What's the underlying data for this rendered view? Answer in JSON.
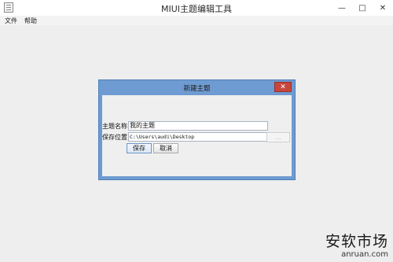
{
  "window": {
    "title": "MIUI主题编辑工具",
    "minimize_glyph": "—",
    "maximize_glyph": "□",
    "close_glyph": "✕"
  },
  "menu": {
    "items": [
      {
        "label": "文件"
      },
      {
        "label": "帮助"
      }
    ]
  },
  "dialog": {
    "title": "新建主题",
    "close_glyph": "✕",
    "fields": {
      "theme_name": {
        "label": "主题名称",
        "value": "我的主题"
      },
      "save_location": {
        "label": "保存位置",
        "value": "C:\\Users\\audi\\Desktop"
      }
    },
    "browse_label": "...",
    "save_label": "保存",
    "cancel_label": "取消",
    "accent": "#6e9bd1",
    "close_color": "#c7463b"
  },
  "watermark": {
    "cn": "安软市场",
    "en": "anruan.com"
  }
}
